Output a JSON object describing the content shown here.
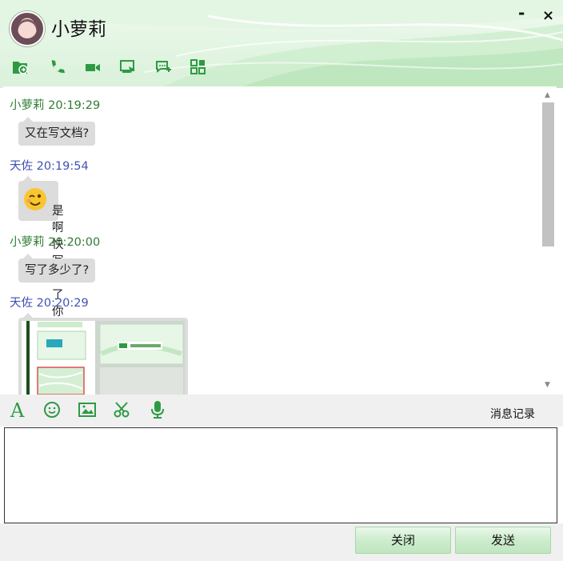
{
  "window": {
    "contact_name": "小萝莉",
    "controls": {
      "minimize": "-",
      "close": "×"
    }
  },
  "toolbar_top": {
    "icons": [
      "file-transfer-icon",
      "voice-call-icon",
      "video-call-icon",
      "remote-desktop-icon",
      "add-chat-icon",
      "apps-grid-icon"
    ]
  },
  "messages": [
    {
      "sender": "小萝莉",
      "time": "20:19:29",
      "header": "小萝莉 20:19:29",
      "text": "又在写文档?"
    },
    {
      "sender": "天佐",
      "time": "20:19:54",
      "header": "天佐 20:19:54",
      "text": "是啊 快写完了 你早点睡啊",
      "emoji": "wink-face-icon"
    },
    {
      "sender": "小萝莉",
      "time": "20:20:00",
      "header": "小萝莉 20:20:00",
      "text": "写了多少了?"
    },
    {
      "sender": "天佐",
      "time": "20:20:29",
      "header": "天佐 20:20:29",
      "image": "screenshot-thumbnail"
    }
  ],
  "input_toolbar": {
    "icons": [
      "font-icon",
      "emoji-icon",
      "image-icon",
      "scissors-icon",
      "microphone-icon"
    ],
    "history_label": "消息记录"
  },
  "input": {
    "value": ""
  },
  "buttons": {
    "close": "关闭",
    "send": "发送"
  },
  "colors": {
    "accent": "#2e9a44",
    "her_name": "#2e7d32",
    "my_name": "#3f51b5",
    "bubble": "#dcdcdc"
  }
}
